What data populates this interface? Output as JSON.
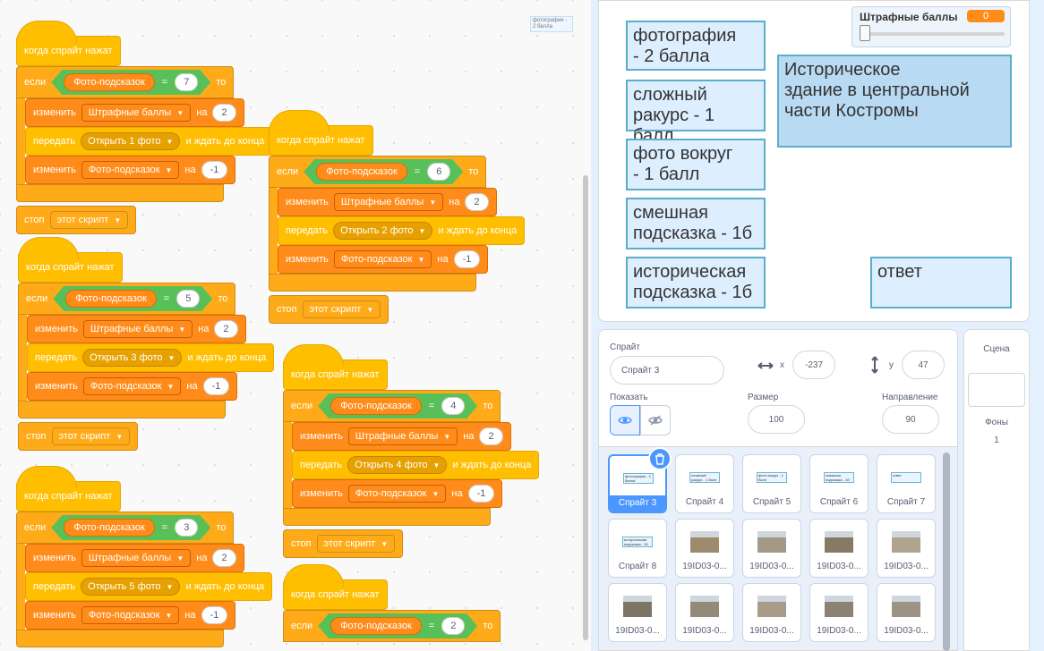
{
  "minimap": {
    "text": "фотография - 2 балла"
  },
  "scripts": [
    {
      "hat": "когда спрайт нажат",
      "if": "если",
      "then": "то",
      "reporter": "Фото-подсказок",
      "eq": "=",
      "value": "7",
      "change_label": "изменить",
      "var1": "Штрафные баллы",
      "by": "на",
      "amount1": "2",
      "broadcast_label": "передать",
      "message": "Открыть 1 фото",
      "wait": "и ждать до конца",
      "var2": "Фото-подсказок",
      "amount2": "-1",
      "stop": "стоп",
      "stop_option": "этот скрипт"
    },
    {
      "hat": "когда спрайт нажат",
      "if": "если",
      "then": "то",
      "reporter": "Фото-подсказок",
      "eq": "=",
      "value": "6",
      "change_label": "изменить",
      "var1": "Штрафные баллы",
      "by": "на",
      "amount1": "2",
      "broadcast_label": "передать",
      "message": "Открыть 2 фото",
      "wait": "и ждать до конца",
      "var2": "Фото-подсказок",
      "amount2": "-1",
      "stop": "стоп",
      "stop_option": "этот скрипт"
    },
    {
      "hat": "когда спрайт нажат",
      "if": "если",
      "then": "то",
      "reporter": "Фото-подсказок",
      "eq": "=",
      "value": "5",
      "change_label": "изменить",
      "var1": "Штрафные баллы",
      "by": "на",
      "amount1": "2",
      "broadcast_label": "передать",
      "message": "Открыть 3 фото",
      "wait": "и ждать до конца",
      "var2": "Фото-подсказок",
      "amount2": "-1",
      "stop": "стоп",
      "stop_option": "этот скрипт"
    },
    {
      "hat": "когда спрайт нажат",
      "if": "если",
      "then": "то",
      "reporter": "Фото-подсказок",
      "eq": "=",
      "value": "4",
      "change_label": "изменить",
      "var1": "Штрафные баллы",
      "by": "на",
      "amount1": "2",
      "broadcast_label": "передать",
      "message": "Открыть 4 фото",
      "wait": "и ждать до конца",
      "var2": "Фото-подсказок",
      "amount2": "-1",
      "stop": "стоп",
      "stop_option": "этот скрипт"
    },
    {
      "hat": "когда спрайт нажат",
      "if": "если",
      "then": "то",
      "reporter": "Фото-подсказок",
      "eq": "=",
      "value": "3",
      "change_label": "изменить",
      "var1": "Штрафные баллы",
      "by": "на",
      "amount1": "2",
      "broadcast_label": "передать",
      "message": "Открыть 5 фото",
      "wait": "и ждать до конца",
      "var2": "Фото-подсказок",
      "amount2": "-1"
    },
    {
      "hat": "когда спрайт нажат",
      "if": "если",
      "then": "то",
      "reporter": "Фото-подсказок",
      "eq": "=",
      "value": "2"
    }
  ],
  "stage": {
    "monitor": {
      "label": "Штрафные баллы",
      "value": "0",
      "slider_fraction": 0
    },
    "notes": [
      {
        "text": "фотография\n - 2 балла"
      },
      {
        "text": "сложный\nракурс - 1 балл"
      },
      {
        "text": "фото вокруг\n - 1 балл"
      },
      {
        "text": "смешная\nподсказка - 1б"
      },
      {
        "text": "историческая\nподсказка - 1б"
      },
      {
        "text": "Историческое\nздание в центральной\nчасти Костромы"
      },
      {
        "text": "ответ"
      }
    ]
  },
  "sprite_info": {
    "sprite_label": "Спрайт",
    "sprite_name": "Спрайт 3",
    "x_label": "x",
    "x_value": "-237",
    "y_label": "y",
    "y_value": "47",
    "show_label": "Показать",
    "size_label": "Размер",
    "size_value": "100",
    "direction_label": "Направление",
    "direction_value": "90"
  },
  "sprites": [
    {
      "name": "Спрайт 3",
      "thumb": "фотография - 2 балла",
      "selected": true
    },
    {
      "name": "Спрайт 4",
      "thumb": "сложный ракурс - 1 балл"
    },
    {
      "name": "Спрайт 5",
      "thumb": "фото вокруг - 1 балл"
    },
    {
      "name": "Спрайт 6",
      "thumb": "смешная подсказка - 1б"
    },
    {
      "name": "Спрайт 7",
      "thumb": "ответ"
    },
    {
      "name": "Спрайт 8",
      "thumb": "историческая подсказка - 1б"
    },
    {
      "name": "19ID03-0..."
    },
    {
      "name": "19ID03-0..."
    },
    {
      "name": "19ID03-0..."
    },
    {
      "name": "19ID03-0..."
    },
    {
      "name": "19ID03-0..."
    },
    {
      "name": "19ID03-0..."
    },
    {
      "name": "19ID03-0..."
    },
    {
      "name": "19ID03-0..."
    },
    {
      "name": "19ID03-0..."
    }
  ],
  "stage_panel": {
    "title": "Сцена",
    "backdrops_label": "Фоны",
    "backdrops_count": "1"
  },
  "colors": {
    "events": "#ffbf00",
    "control": "#ffab19",
    "variables": "#ff8c1a",
    "operators": "#59c059",
    "selected": "#4c97ff"
  }
}
